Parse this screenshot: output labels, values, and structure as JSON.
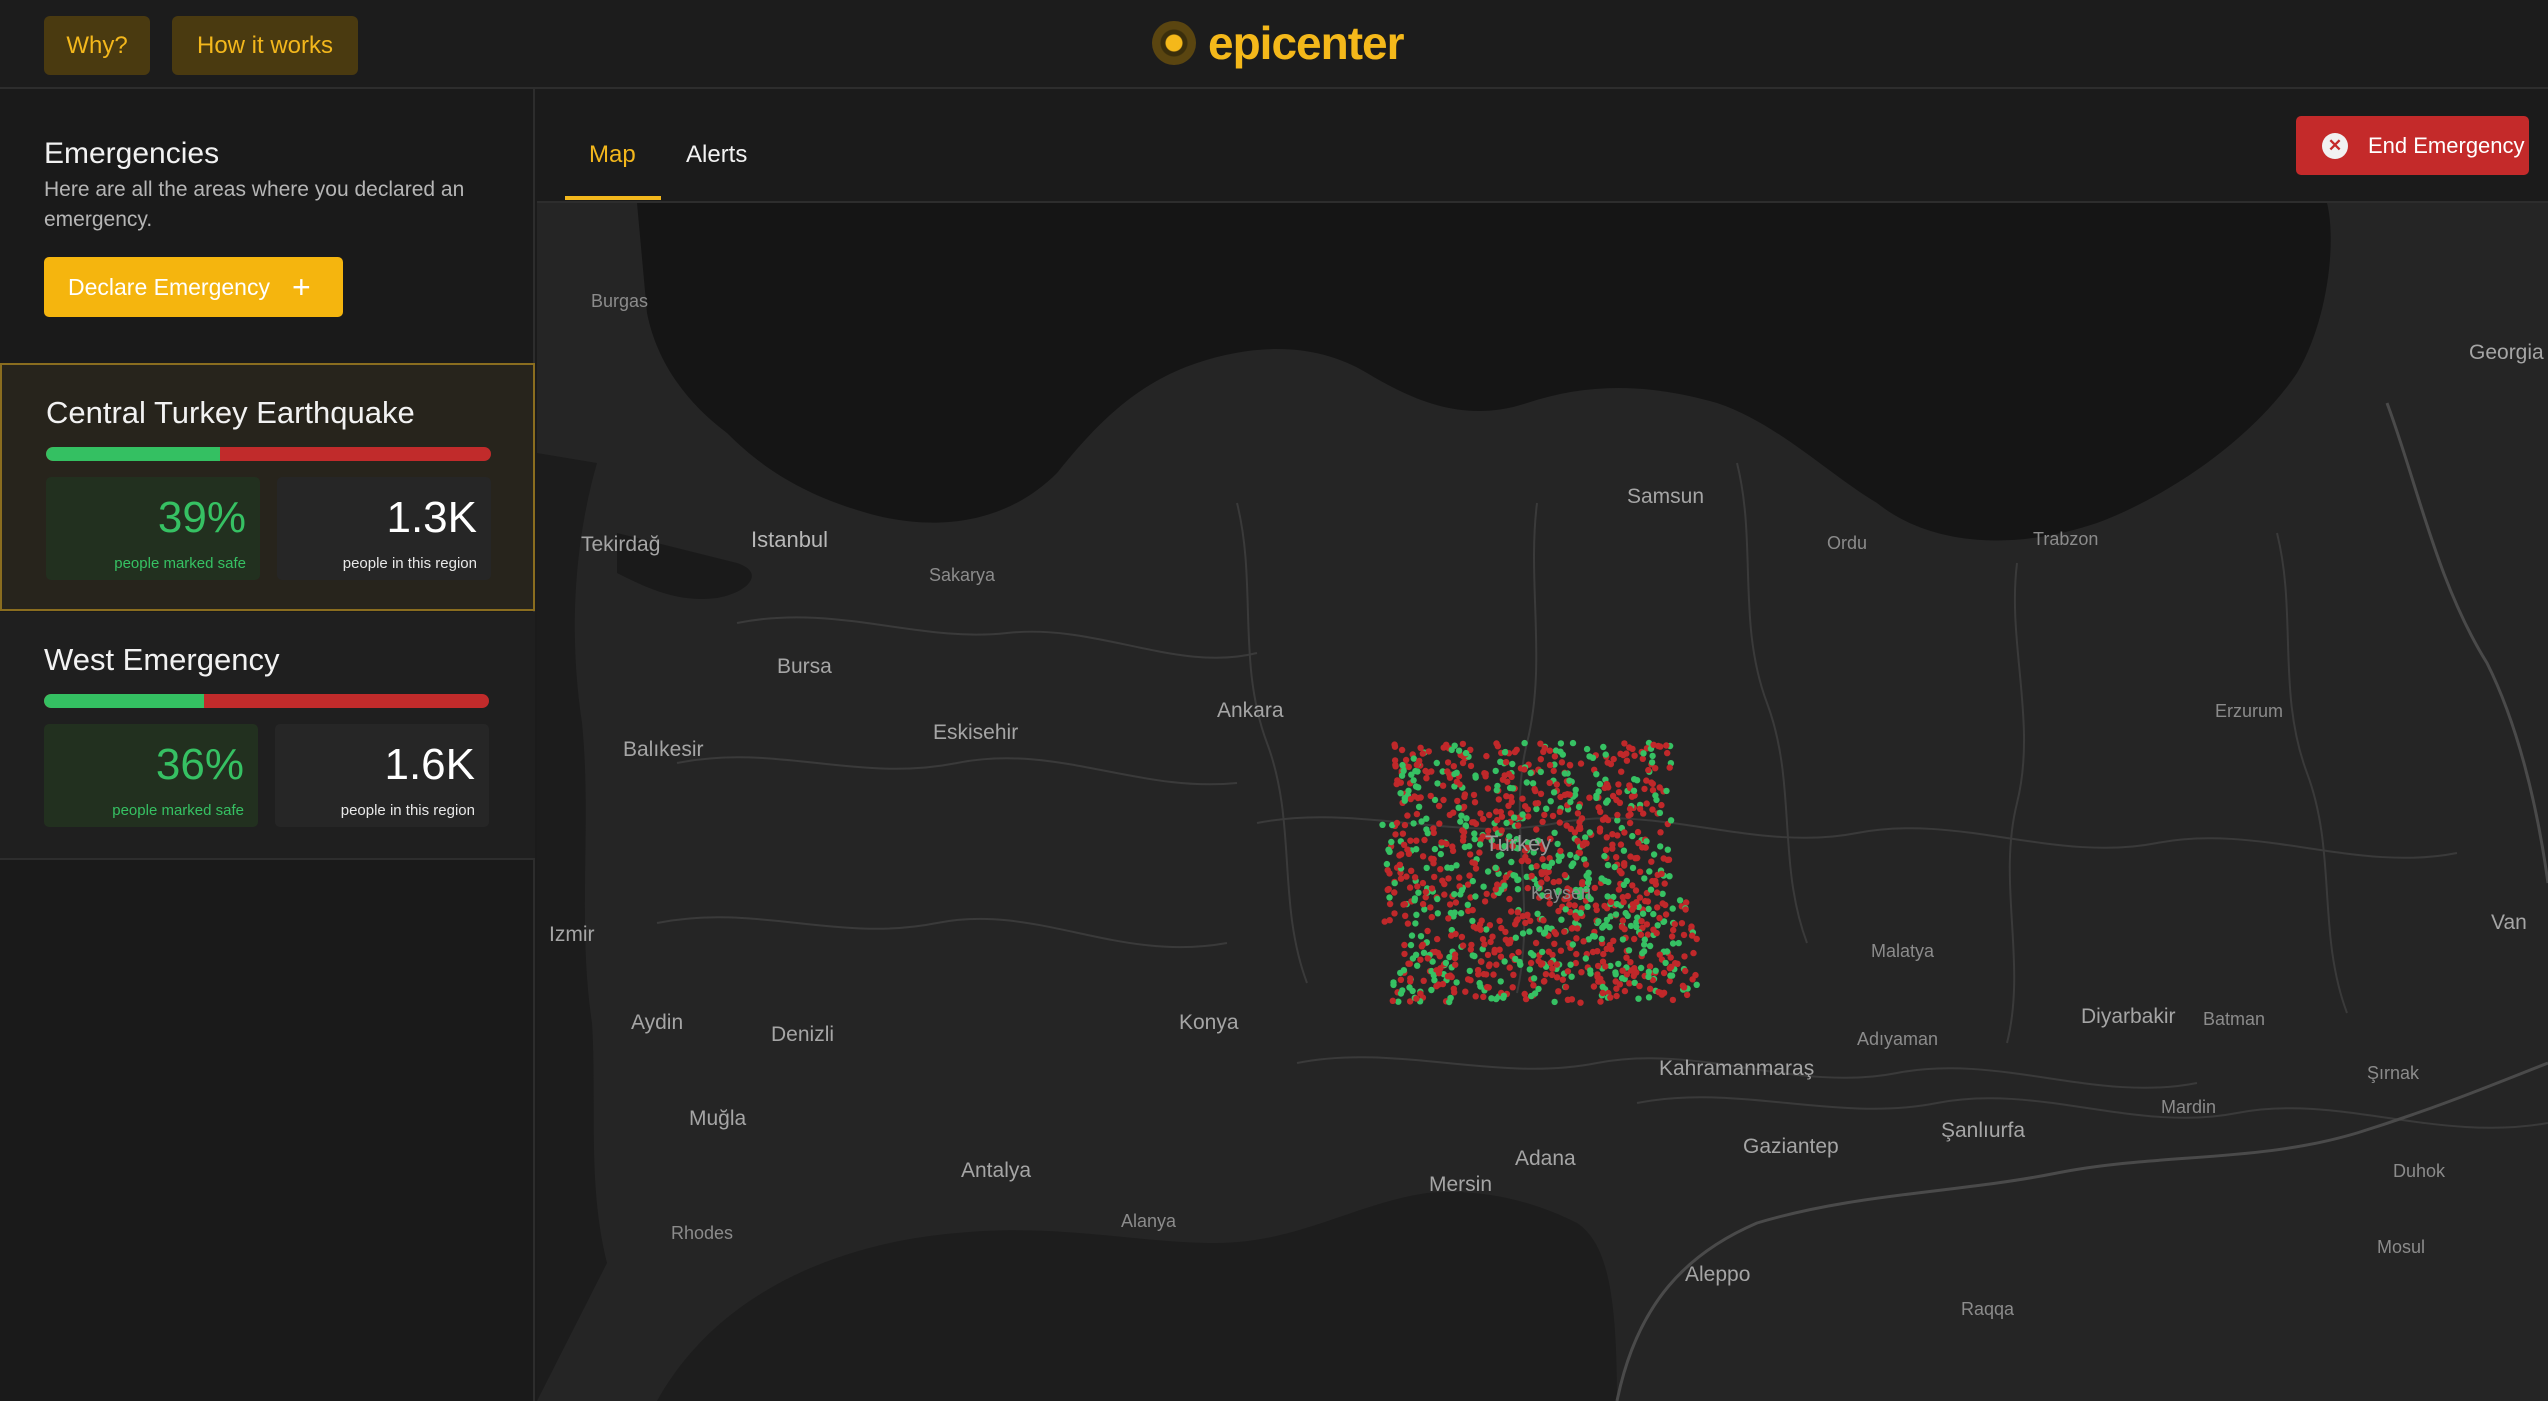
{
  "topbar": {
    "why_label": "Why?",
    "how_label": "How it works",
    "logo_text": "epicenter"
  },
  "sidebar": {
    "title": "Emergencies",
    "description": "Here are all the areas where you declared an emergency.",
    "declare_label": "Declare Emergency",
    "emergencies": [
      {
        "name": "Central Turkey Earthquake",
        "safe_fraction": 0.39,
        "safe_value": "39%",
        "safe_caption": "people marked safe",
        "population_value": "1.3K",
        "population_caption": "people in this region",
        "selected": true
      },
      {
        "name": "West Emergency",
        "safe_fraction": 0.36,
        "safe_value": "36%",
        "safe_caption": "people marked safe",
        "population_value": "1.6K",
        "population_caption": "people in this region",
        "selected": false
      }
    ]
  },
  "tabs": {
    "map_label": "Map",
    "alerts_label": "Alerts",
    "active": "Map"
  },
  "end_emergency_label": "End Emergency",
  "map": {
    "labels": {
      "burgas": "Burgas",
      "georgia": "Georgia",
      "samsun": "Samsun",
      "tekirdag": "Tekirdağ",
      "istanbul": "Istanbul",
      "ordu": "Ordu",
      "trabzon": "Trabzon",
      "sakarya": "Sakarya",
      "bursa": "Bursa",
      "ankara": "Ankara",
      "erzurum": "Erzurum",
      "eskisehir": "Eskisehir",
      "balikesir": "Balıkesir",
      "turkey": "Turkey",
      "kayseri": "Kayseri",
      "izmir": "Izmir",
      "van": "Van",
      "malatya": "Malatya",
      "aydin": "Aydin",
      "konya": "Konya",
      "denizli": "Denizli",
      "adiyaman": "Adıyaman",
      "diyarbakir": "Diyarbakir",
      "batman": "Batman",
      "kahramanmaras": "Kahramanmaraş",
      "sirnak": "Şırnak",
      "mardin": "Mardin",
      "mugla": "Muğla",
      "sanliurfa": "Şanlıurfa",
      "antalya": "Antalya",
      "gaziantep": "Gaziantep",
      "adana": "Adana",
      "duhok": "Duhok",
      "mersin": "Mersin",
      "alanya": "Alanya",
      "rhodes": "Rhodes",
      "mosul": "Mosul",
      "aleppo": "Aleppo",
      "raqqa": "Raqqa"
    },
    "status_colors": {
      "safe": "#36c163",
      "unsafe": "#c0282a"
    },
    "dot_count": 1300,
    "safe_fraction": 0.39
  },
  "colors": {
    "accent": "#f3b71c",
    "danger": "#c42a2a",
    "success": "#36c163",
    "background": "#1b1b1b"
  },
  "icons": {
    "logo": "epicenter-logo-icon",
    "plus": "plus-icon",
    "close": "close-circle-icon"
  }
}
